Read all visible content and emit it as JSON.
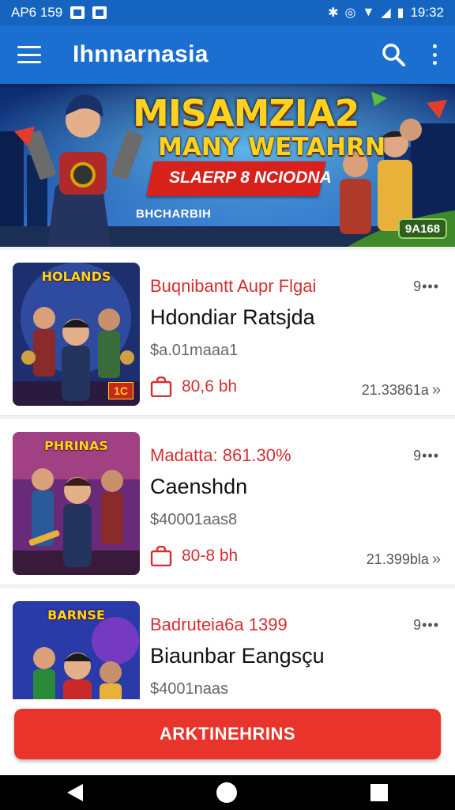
{
  "status_bar": {
    "left_text": "AP6 159",
    "right_text": "19:32"
  },
  "app_bar": {
    "title": "Ihnnarnasia"
  },
  "banner": {
    "title": "MISAMZIA2",
    "subtitle": "MANY WETAHRN",
    "ribbon_text": "SLAERP 8 NCIODNA",
    "caption": "BHCHARBIH",
    "badge": "9A168"
  },
  "games": [
    {
      "thumb_title": "HOLANDS",
      "thumb_tag": "1C",
      "subtitle": "Buqnibantt Aupr Flgai",
      "title": "Hdondiar Ratsjda",
      "price": "$a.01maaa1",
      "size": "80,6 bh",
      "meta": "21.33861a",
      "dots": "9•••"
    },
    {
      "thumb_title": "PHRINAS",
      "thumb_tag": "",
      "subtitle": "Madatta: 861.30%",
      "title": "Caenshdn",
      "price": "$40001aas8",
      "size": "80-8 bh",
      "meta": "21.399bla",
      "dots": "9•••"
    },
    {
      "thumb_title": "BARNSE",
      "thumb_tag": "",
      "subtitle": "Badruteia6a 1399",
      "title": "Biaunbar Eangsçu",
      "price": "$4001naas",
      "size": "",
      "meta": "",
      "dots": "9•••"
    }
  ],
  "primary_button": {
    "label": "ARKTINEHRINS"
  }
}
